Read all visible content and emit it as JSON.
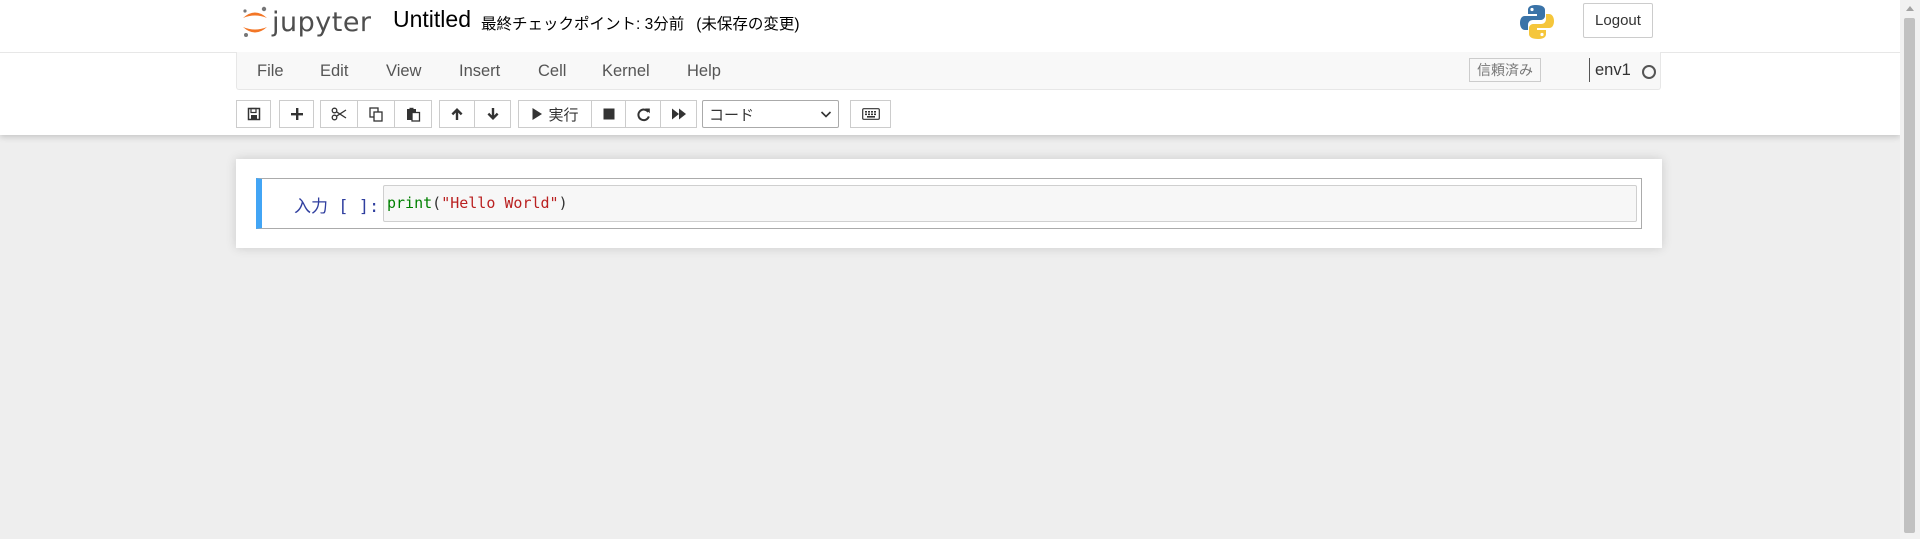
{
  "header": {
    "logo_text": "jupyter",
    "notebook_name": "Untitled",
    "checkpoint_text": "最終チェックポイント: 3分前",
    "unsaved_text": "(未保存の変更)",
    "logout_label": "Logout"
  },
  "menubar": {
    "items": [
      "File",
      "Edit",
      "View",
      "Insert",
      "Cell",
      "Kernel",
      "Help"
    ],
    "trusted_label": "信頼済み",
    "kernel_name": "env1"
  },
  "toolbar": {
    "run_label": "実行",
    "cell_type": "コード"
  },
  "cell": {
    "prompt": "入力 [ ]:",
    "code": {
      "fn": "print",
      "open": "(",
      "str": "\"Hello World\"",
      "close": ")"
    }
  },
  "colors": {
    "cell_selected_border": "#42a5f5",
    "jupyter_orange": "#f37626",
    "prompt_blue": "#303f9f",
    "code_builtin": "#008000",
    "code_string": "#ba2121"
  },
  "icons": {
    "toolbar": [
      "save-icon",
      "plus-icon",
      "scissors-icon",
      "copy-icon",
      "paste-icon",
      "arrow-up-icon",
      "arrow-down-icon",
      "play-icon",
      "stop-icon",
      "refresh-icon",
      "fast-forward-icon",
      "keyboard-icon"
    ],
    "header": [
      "jupyter-logo-icon",
      "python-logo-icon"
    ],
    "status": "kernel-idle-circle-icon"
  }
}
